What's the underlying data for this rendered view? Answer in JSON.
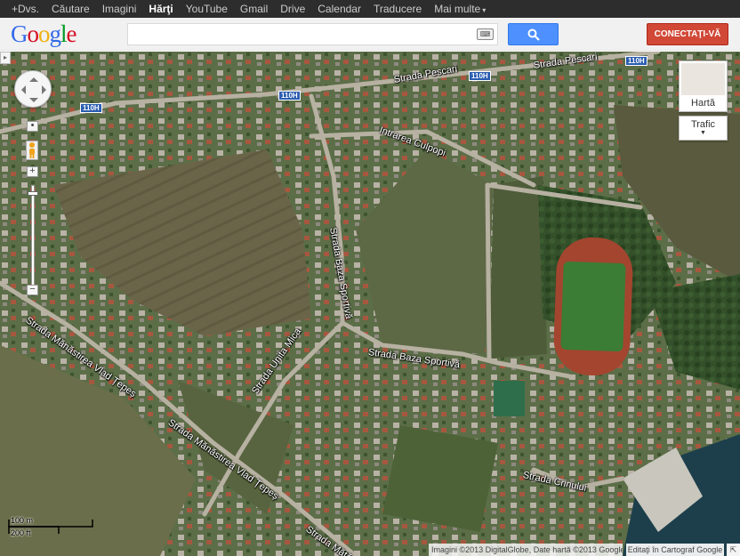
{
  "gbar": {
    "items": [
      {
        "label": "+Dvs.",
        "selected": false
      },
      {
        "label": "Căutare",
        "selected": false
      },
      {
        "label": "Imagini",
        "selected": false
      },
      {
        "label": "Hărţi",
        "selected": true
      },
      {
        "label": "YouTube",
        "selected": false
      },
      {
        "label": "Gmail",
        "selected": false
      },
      {
        "label": "Drive",
        "selected": false
      },
      {
        "label": "Calendar",
        "selected": false
      },
      {
        "label": "Traducere",
        "selected": false
      },
      {
        "label": "Mai multe",
        "selected": false
      }
    ],
    "more_caret": "▾"
  },
  "header": {
    "logo_letters": [
      {
        "ch": "G",
        "color": "#3369e8"
      },
      {
        "ch": "o",
        "color": "#d50f25"
      },
      {
        "ch": "o",
        "color": "#eeb211"
      },
      {
        "ch": "g",
        "color": "#3369e8"
      },
      {
        "ch": "l",
        "color": "#009925"
      },
      {
        "ch": "e",
        "color": "#d50f25"
      }
    ],
    "search_value": "",
    "keyboard_icon": "keyboard-icon",
    "search_icon": "search-icon",
    "signin_label": "CONECTAŢI-VĂ"
  },
  "map": {
    "type": "satellite",
    "street_labels": [
      "Strada Pescari",
      "Strada Pescari",
      "Intrarea Culpopi",
      "Strada Baza Sportivă",
      "Strada Baza Sportivă",
      "Strada Mănăstirea Vlad Țepeș",
      "Strada Mănăstirea Vlad Țepeș",
      "Strada Unita Mica",
      "Strada Crinului",
      "Strada Mătăc"
    ],
    "road_shields": [
      "110H",
      "110H",
      "110H",
      "110H"
    ],
    "map_type_button": "Hartă",
    "traffic_button": "Trafic",
    "scale": {
      "metric": "100 m",
      "imperial": "200 ft"
    },
    "attribution": "Imagini ©2013 DigitalGlobe, Date hartă ©2013 Google",
    "edit_link": "Editaţi în Cartograf Google",
    "corner_arrow": "⇱"
  }
}
